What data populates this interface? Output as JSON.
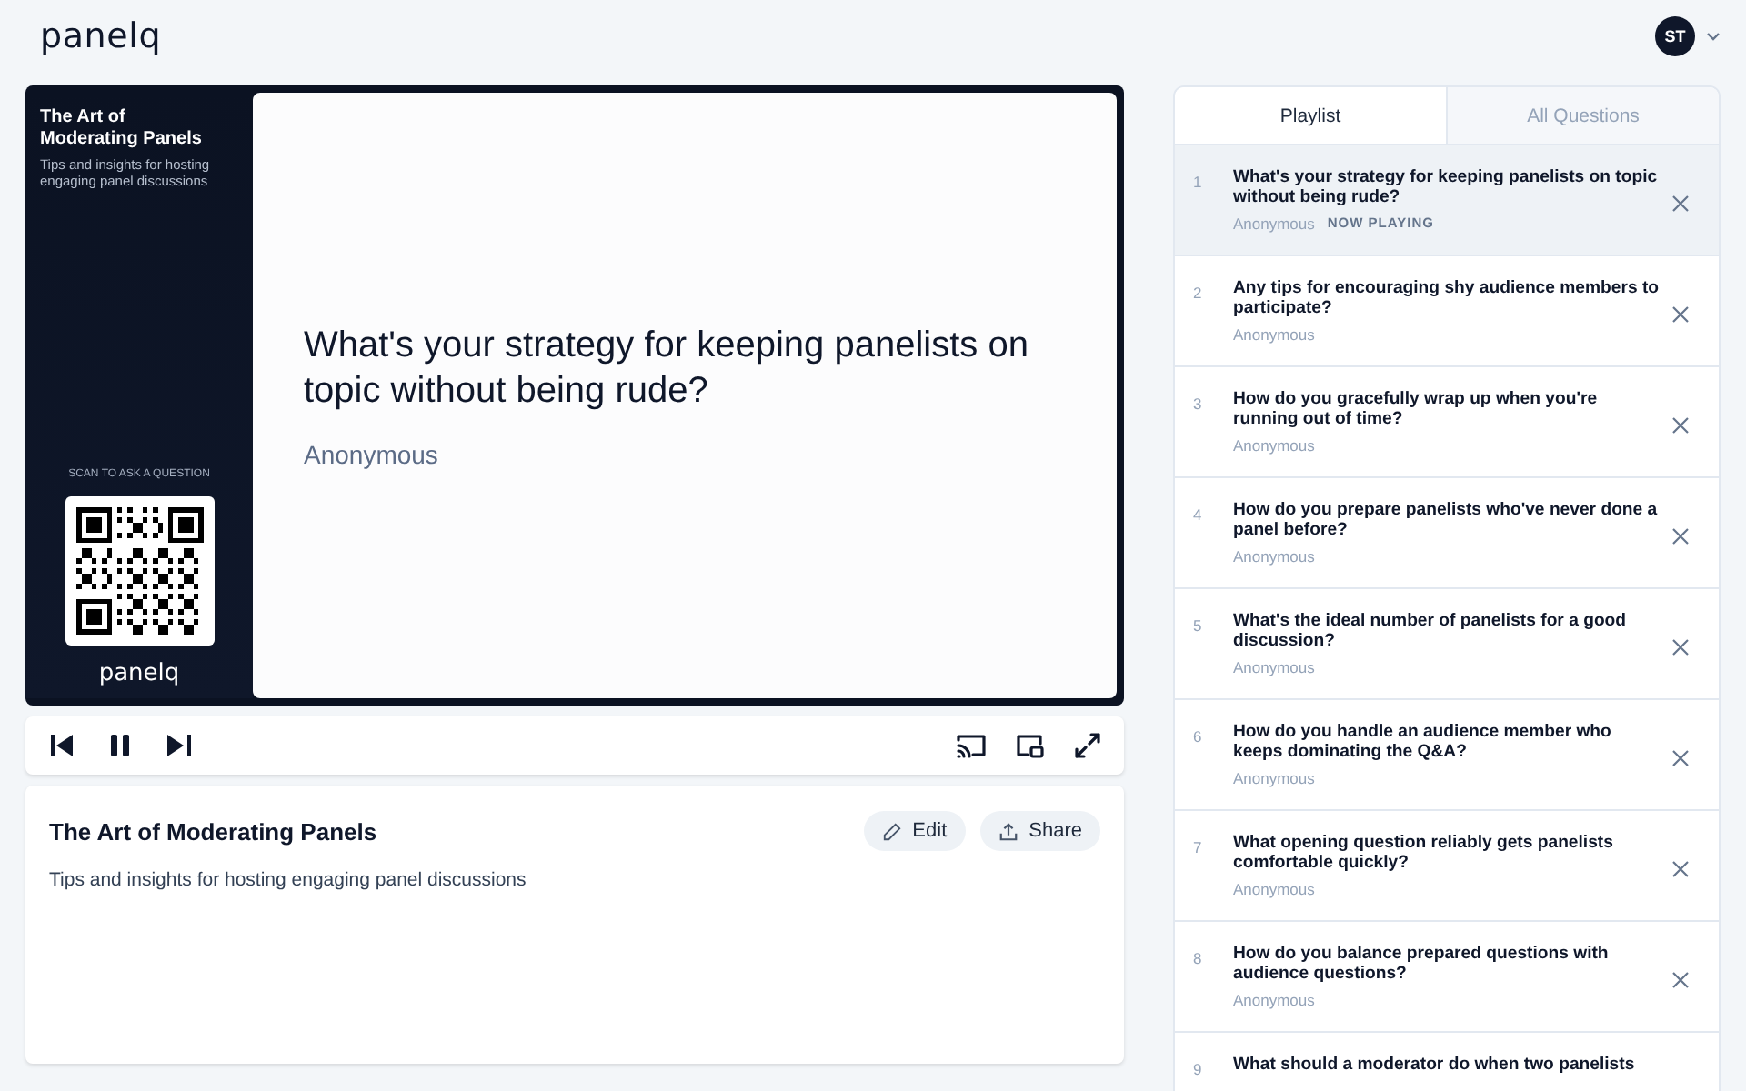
{
  "header": {
    "logo": "panelq",
    "avatar_initials": "ST"
  },
  "player": {
    "sidebar": {
      "title": "The Art of Moderating Panels",
      "subtitle": "Tips and insights for hosting engaging panel discussions",
      "scan_label": "SCAN TO ASK A QUESTION",
      "brand": "panelq"
    },
    "slide": {
      "question": "What's your strategy for keeping panelists on topic without being rude?",
      "author": "Anonymous"
    }
  },
  "info": {
    "title": "The Art of Moderating Panels",
    "description": "Tips and insights for hosting engaging panel discussions",
    "buttons": [
      "Edit",
      "Share"
    ]
  },
  "tabs": [
    {
      "label": "Playlist",
      "selected": true
    },
    {
      "label": "All Questions",
      "selected": false
    }
  ],
  "playlist": [
    {
      "number": "1",
      "question": "What's your strategy for keeping panelists on topic without being rude?",
      "author": "Anonymous",
      "status": "NOW PLAYING",
      "selected": true
    },
    {
      "number": "2",
      "question": "Any tips for encouraging shy audience members to participate?",
      "author": "Anonymous",
      "selected": false
    },
    {
      "number": "3",
      "question": "How do you gracefully wrap up when you're running out of time?",
      "author": "Anonymous",
      "selected": false
    },
    {
      "number": "4",
      "question": "How do you prepare panelists who've never done a panel before?",
      "author": "Anonymous",
      "selected": false
    },
    {
      "number": "5",
      "question": "What's the ideal number of panelists for a good discussion?",
      "author": "Anonymous",
      "selected": false
    },
    {
      "number": "6",
      "question": "How do you handle an audience member who keeps dominating the Q&A?",
      "author": "Anonymous",
      "selected": false
    },
    {
      "number": "7",
      "question": "What opening question reliably gets panelists comfortable quickly?",
      "author": "Anonymous",
      "selected": false
    },
    {
      "number": "8",
      "question": "How do you balance prepared questions with audience questions?",
      "author": "Anonymous",
      "selected": false
    },
    {
      "number": "9",
      "question": "What should a moderator do when two panelists",
      "selected": false
    }
  ]
}
